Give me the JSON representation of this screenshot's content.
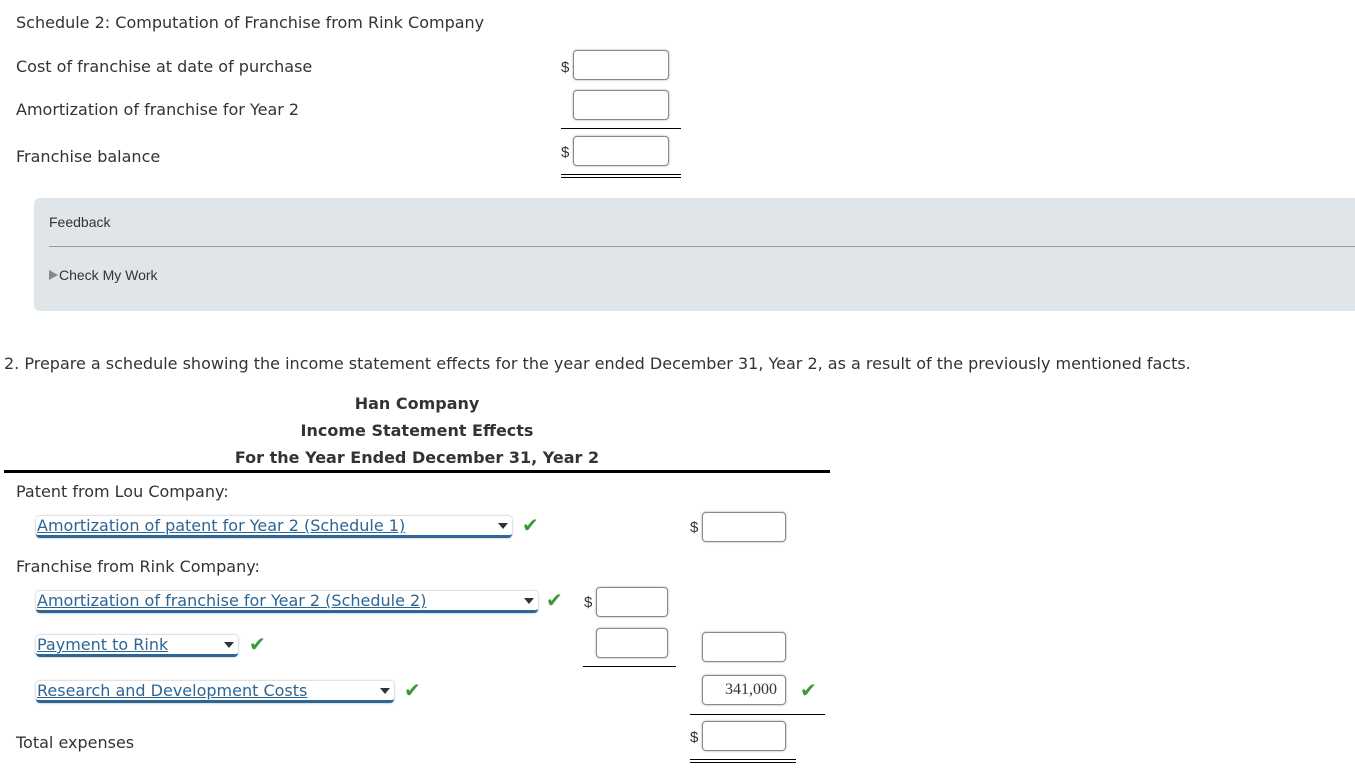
{
  "schedule2": {
    "title": "Schedule 2: Computation of Franchise from Rink Company",
    "rows": [
      {
        "label": "Cost of franchise at date of purchase",
        "currency": "$",
        "value": ""
      },
      {
        "label": "Amortization of franchise for Year 2",
        "currency": "",
        "value": ""
      },
      {
        "label": "Franchise balance",
        "currency": "$",
        "value": ""
      }
    ]
  },
  "feedback": {
    "title": "Feedback",
    "check_my_work": "Check My Work"
  },
  "question2": {
    "prompt": "2. Prepare a schedule showing the income statement effects for the year ended December 31, Year 2, as a result of the previously mentioned facts."
  },
  "statement": {
    "company": "Han Company",
    "title": "Income Statement Effects",
    "period": "For the Year Ended December 31, Year 2",
    "sections": [
      {
        "heading": "Patent from Lou Company:",
        "items": [
          {
            "select": "Amortization of patent for Year 2 (Schedule 1)",
            "correct": true,
            "currency": "$",
            "value": ""
          }
        ]
      },
      {
        "heading": "Franchise from Rink Company:",
        "items": [
          {
            "select": "Amortization of franchise for Year 2 (Schedule 2)",
            "correct": true,
            "currency": "$",
            "value": ""
          },
          {
            "select": "Payment to Rink",
            "correct": true,
            "currency": "",
            "value": ""
          }
        ],
        "subtotal": ""
      },
      {
        "heading": "",
        "items": [
          {
            "select": "Research and Development Costs",
            "correct": true,
            "currency": "",
            "value": "341,000",
            "value_correct": true
          }
        ]
      }
    ],
    "total": {
      "label": "Total expenses",
      "currency": "$",
      "value": ""
    }
  },
  "icons": {
    "check": "✔"
  },
  "colors": {
    "link": "#2d6595",
    "check": "#3a9a35",
    "feedback_bg": "#dfe5e8"
  }
}
